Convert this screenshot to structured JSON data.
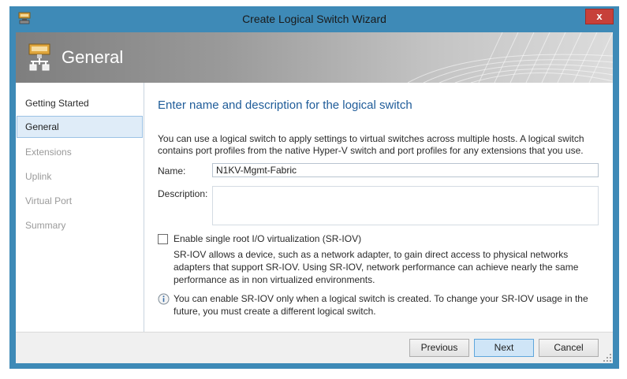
{
  "window": {
    "title": "Create Logical Switch Wizard",
    "close_label": "x",
    "accent_color": "#3e8ab7"
  },
  "banner": {
    "title": "General",
    "icon": "logical-switch-icon"
  },
  "nav": {
    "items": [
      {
        "label": "Getting Started",
        "state": "done"
      },
      {
        "label": "General",
        "state": "active"
      },
      {
        "label": "Extensions",
        "state": "pending"
      },
      {
        "label": "Uplink",
        "state": "pending"
      },
      {
        "label": "Virtual Port",
        "state": "pending"
      },
      {
        "label": "Summary",
        "state": "pending"
      }
    ]
  },
  "main": {
    "heading": "Enter name and description for the logical switch",
    "intro_line1": "You can use a logical switch to apply settings to virtual switches across multiple hosts. A logical switch",
    "intro_line2": "contains port profiles from the native Hyper-V switch and port profiles for any extensions that you use.",
    "name_label": "Name:",
    "name_value": "N1KV-Mgmt-Fabric",
    "description_label": "Description:",
    "description_value": "",
    "sriov_checked": false,
    "sriov_label": "Enable single root I/O virtualization (SR-IOV)",
    "sriov_desc_line1": "SR-IOV allows a device, such as a network adapter, to gain direct access to physical networks",
    "sriov_desc_line2": "adapters that support SR-IOV. Using SR-IOV, network performance can achieve nearly the same",
    "sriov_desc_line3": "performance as in non virtualized environments.",
    "info_line1": "You can enable SR-IOV only when a logical switch is created. To change your SR-IOV usage in the",
    "info_line2": "future, you must create a different logical switch."
  },
  "footer": {
    "previous_label": "Previous",
    "next_label": "Next",
    "cancel_label": "Cancel"
  }
}
